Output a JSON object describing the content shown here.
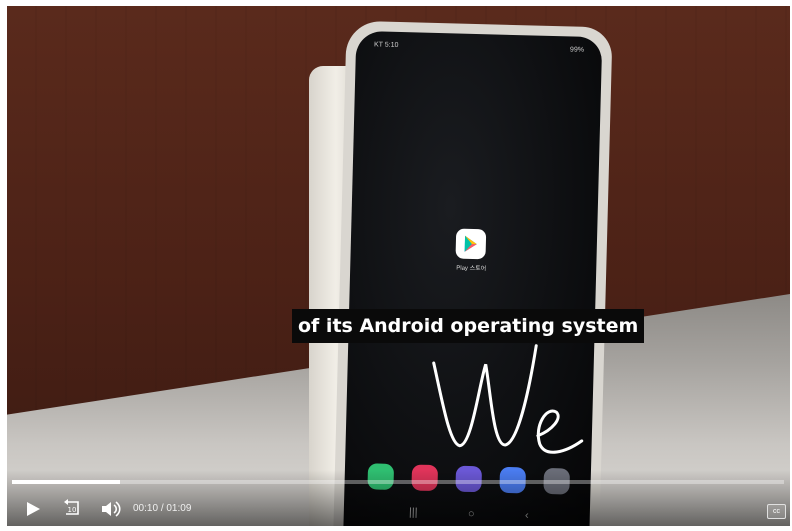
{
  "phone": {
    "status_left": "KT 5:10",
    "status_right": "99%",
    "app_label": "Play 스토어"
  },
  "caption": {
    "text": "of its Android operating system"
  },
  "player": {
    "current_time": "00:10",
    "separator": "/",
    "duration": "01:09",
    "rewind_seconds": "10",
    "cc_label": "cc",
    "progress_fraction": 0.14
  },
  "colors": {
    "caption_bg": "#0a0a0a",
    "caption_text": "#ffffff"
  },
  "icons": {
    "play": "play-icon",
    "rewind": "rewind-10-icon",
    "volume": "volume-icon",
    "captions": "closed-captions-icon"
  }
}
